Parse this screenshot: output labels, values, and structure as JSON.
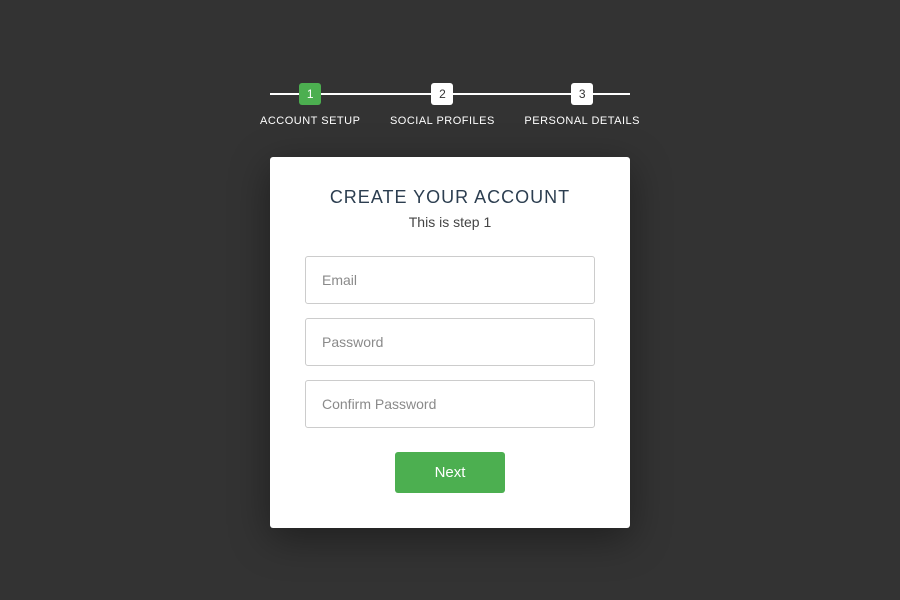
{
  "progress": {
    "steps": [
      {
        "number": "1",
        "label": "Account Setup",
        "active": true
      },
      {
        "number": "2",
        "label": "Social Profiles",
        "active": false
      },
      {
        "number": "3",
        "label": "Personal Details",
        "active": false
      }
    ]
  },
  "card": {
    "title": "Create your account",
    "subtitle": "This is step 1",
    "fields": {
      "email_placeholder": "Email",
      "password_placeholder": "Password",
      "confirm_placeholder": "Confirm Password"
    },
    "next_label": "Next"
  }
}
